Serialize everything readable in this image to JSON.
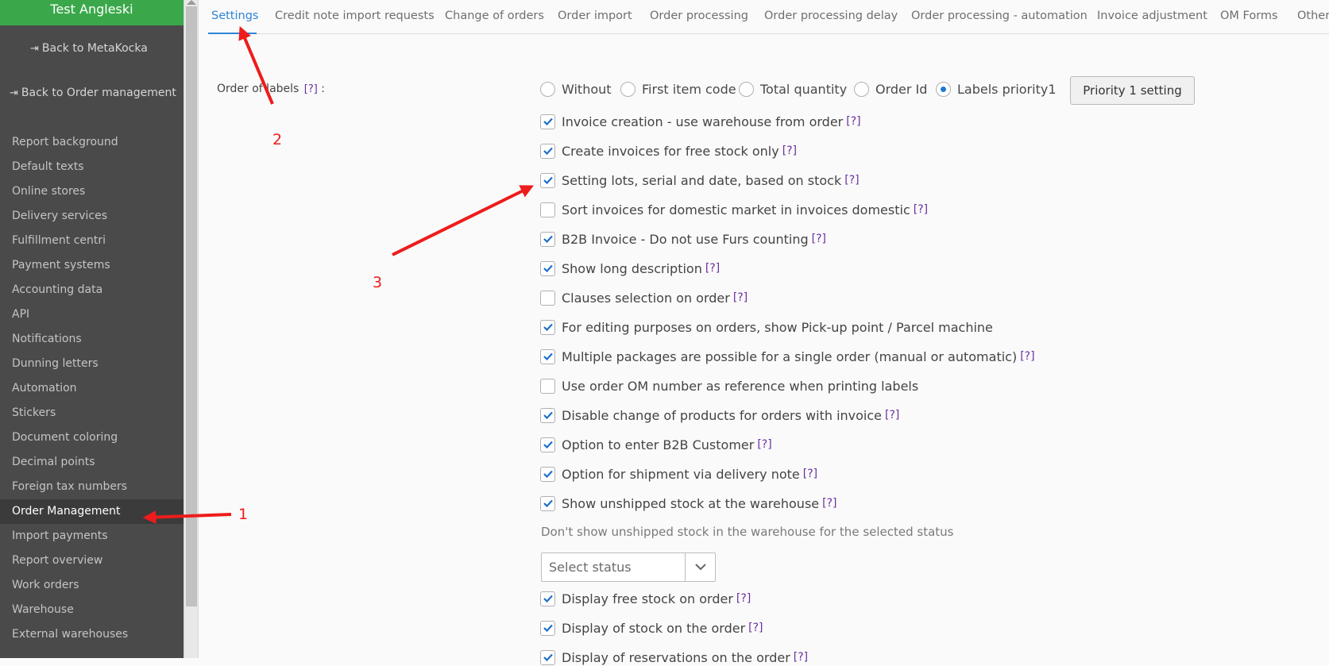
{
  "sidebar": {
    "header": "Test Angleski",
    "back_metakocka": "Back to MetaKocka",
    "back_order_mgmt": "Back to Order management",
    "items": [
      "Report background",
      "Default texts",
      "Online stores",
      "Delivery services",
      "Fulfillment centri",
      "Payment systems",
      "Accounting data",
      "API",
      "Notifications",
      "Dunning letters",
      "Automation",
      "Stickers",
      "Document coloring",
      "Decimal points",
      "Foreign tax numbers",
      "Order Management",
      "Import payments",
      "Report overview",
      "Work orders",
      "Warehouse",
      "External warehouses"
    ],
    "active_item": "Order Management"
  },
  "tabs": [
    "Settings",
    "Credit note import requests",
    "Change of orders",
    "Order import",
    "Order processing",
    "Order processing delay",
    "Order processing - automation",
    "Invoice adjustment",
    "OM Forms",
    "Other"
  ],
  "active_tab": "Settings",
  "order_of_labels": {
    "label": "Order of labels",
    "help": "[?]",
    "suffix": ":",
    "options": [
      "Without",
      "First item code",
      "Total quantity",
      "Order Id",
      "Labels priority1"
    ],
    "selected": "Labels priority1",
    "button": "Priority 1 setting"
  },
  "help_text": "[?]",
  "checkboxes": [
    {
      "label": "Invoice creation - use warehouse from order",
      "checked": true,
      "help": true
    },
    {
      "label": "Create invoices for free stock only",
      "checked": true,
      "help": true
    },
    {
      "label": "Setting lots, serial and date, based on stock",
      "checked": true,
      "help": true
    },
    {
      "label": "Sort invoices for domestic market in invoices domestic",
      "checked": false,
      "help": true
    },
    {
      "label": "B2B Invoice - Do not use Furs counting",
      "checked": true,
      "help": true
    },
    {
      "label": "Show long description",
      "checked": true,
      "help": true
    },
    {
      "label": "Clauses selection on order",
      "checked": false,
      "help": true
    },
    {
      "label": "For editing purposes on orders, show Pick-up point / Parcel machine",
      "checked": true,
      "help": false
    },
    {
      "label": "Multiple packages are possible for a single order (manual or automatic)",
      "checked": true,
      "help": true
    },
    {
      "label": "Use order OM number as reference when printing labels",
      "checked": false,
      "help": false
    },
    {
      "label": "Disable change of products for orders with invoice",
      "checked": true,
      "help": true
    },
    {
      "label": "Option to enter B2B Customer",
      "checked": true,
      "help": true
    },
    {
      "label": "Option for shipment via delivery note",
      "checked": true,
      "help": true
    },
    {
      "label": "Show unshipped stock at the warehouse",
      "checked": true,
      "help": true
    }
  ],
  "status_filter": {
    "caption": "Don't show unshipped stock in the warehouse for the selected status",
    "placeholder": "Select status"
  },
  "checkboxes_after": [
    {
      "label": "Display free stock on order",
      "checked": true,
      "help": true
    },
    {
      "label": "Display of stock on the order",
      "checked": true,
      "help": true
    },
    {
      "label": "Display of reservations on the order",
      "checked": true,
      "help": true
    }
  ],
  "annotations": [
    "1",
    "2",
    "3"
  ],
  "colors": {
    "accent": "#2e85d6",
    "header_green": "#3aa84a",
    "annotation_red": "#ee1c1c",
    "sidebar_bg": "#4a4a4a",
    "help_purple": "#6a2fa0"
  }
}
